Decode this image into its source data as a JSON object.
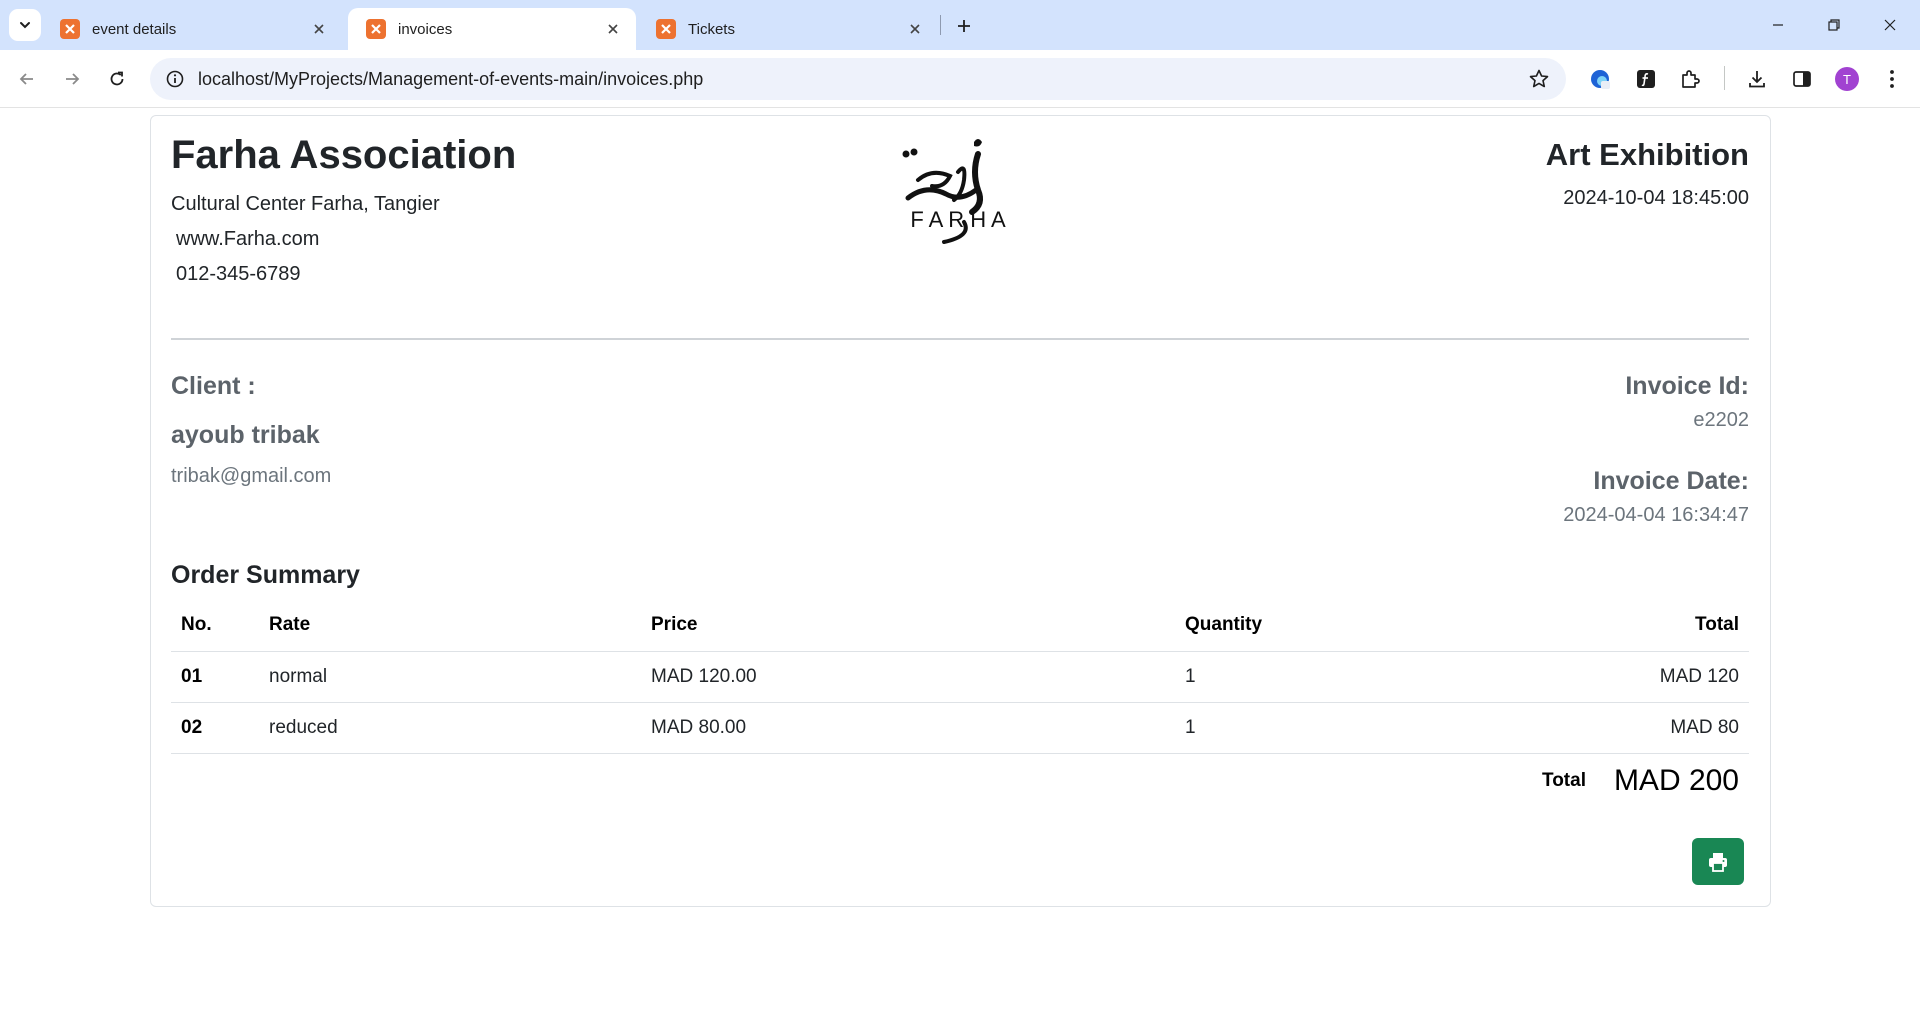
{
  "browser": {
    "tabs": [
      {
        "title": "event details",
        "active": false
      },
      {
        "title": "invoices",
        "active": true
      },
      {
        "title": "Tickets",
        "active": false
      }
    ],
    "url": "localhost/MyProjects/Management-of-events-main/invoices.php",
    "profile_initial": "T",
    "colors": {
      "tabstrip": "#d3e3fd",
      "favicon": "#ed7230",
      "avatar": "#a142d1"
    }
  },
  "organization": {
    "name": "Farha Association",
    "address": "Cultural Center Farha, Tangier",
    "website": "www.Farha.com",
    "phone": "012-345-6789",
    "logo_text": "F A R H A"
  },
  "event": {
    "title": "Art Exhibition",
    "datetime": "2024-10-04 18:45:00"
  },
  "client": {
    "label": "Client :",
    "name": "ayoub tribak",
    "email": "tribak@gmail.com"
  },
  "invoice": {
    "id_label": "Invoice Id:",
    "id": "e2202",
    "date_label": "Invoice Date:",
    "date": "2024-04-04 16:34:47"
  },
  "order": {
    "title": "Order Summary",
    "columns": [
      "No.",
      "Rate",
      "Price",
      "Quantity",
      "Total"
    ],
    "rows": [
      {
        "no": "01",
        "rate": "normal",
        "price": "MAD 120.00",
        "quantity": "1",
        "total": "MAD 120"
      },
      {
        "no": "02",
        "rate": "reduced",
        "price": "MAD 80.00",
        "quantity": "1",
        "total": "MAD 80"
      }
    ],
    "total_label": "Total",
    "total_value": "MAD 200"
  },
  "actions": {
    "print_icon": "printer-icon",
    "print_color": "#198754"
  }
}
